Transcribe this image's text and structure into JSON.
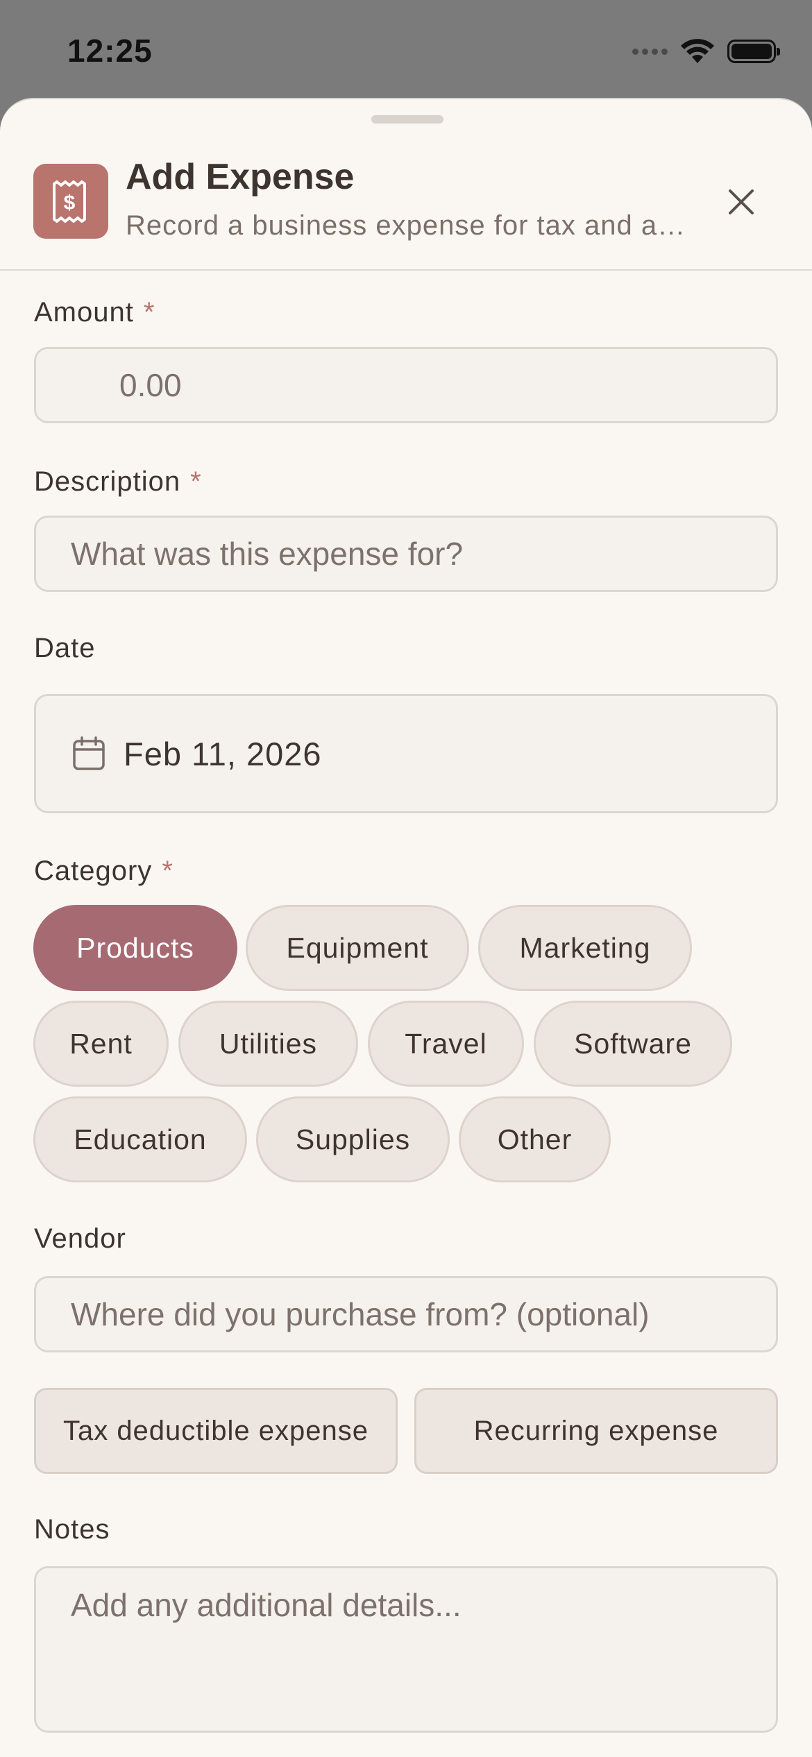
{
  "status_bar": {
    "time": "12:25"
  },
  "header": {
    "title": "Add Expense",
    "subtitle": "Record a business expense for tax and accounting"
  },
  "form": {
    "amount": {
      "label": "Amount",
      "required_mark": "*",
      "placeholder": "0.00"
    },
    "description": {
      "label": "Description",
      "required_mark": "*",
      "placeholder": "What was this expense for?"
    },
    "date": {
      "label": "Date",
      "value": "Feb 11, 2026"
    },
    "category": {
      "label": "Category",
      "required_mark": "*",
      "selected": "Products",
      "options": [
        "Products",
        "Equipment",
        "Marketing",
        "Rent",
        "Utilities",
        "Travel",
        "Software",
        "Education",
        "Supplies",
        "Other"
      ]
    },
    "vendor": {
      "label": "Vendor",
      "placeholder": "Where did you purchase from? (optional)"
    },
    "toggles": {
      "tax_deductible": "Tax deductible expense",
      "recurring": "Recurring expense"
    },
    "notes": {
      "label": "Notes",
      "placeholder": "Add any additional details..."
    }
  },
  "colors": {
    "accent": "#b8746d",
    "selected_chip": "#a66a73",
    "sheet_bg": "#faf7f3"
  }
}
